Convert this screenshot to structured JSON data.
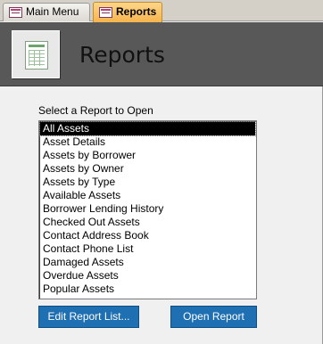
{
  "tabs": [
    {
      "label": "Main Menu",
      "active": false
    },
    {
      "label": "Reports",
      "active": true
    }
  ],
  "header": {
    "title": "Reports",
    "icon": "report-icon"
  },
  "form": {
    "prompt": "Select a Report to Open",
    "reports": [
      "All Assets",
      "Asset Details",
      "Assets by Borrower",
      "Assets by Owner",
      "Assets by Type",
      "Available Assets",
      "Borrower Lending History",
      "Checked Out Assets",
      "Contact Address Book",
      "Contact Phone List",
      "Damaged Assets",
      "Overdue Assets",
      "Popular Assets"
    ],
    "selected_report": "All Assets",
    "edit_button": "Edit Report List...",
    "open_button": "Open Report"
  },
  "colors": {
    "active_tab": "#f6b44d",
    "header_band": "#585858",
    "button": "#1f6fb3",
    "selection": "#000000"
  }
}
